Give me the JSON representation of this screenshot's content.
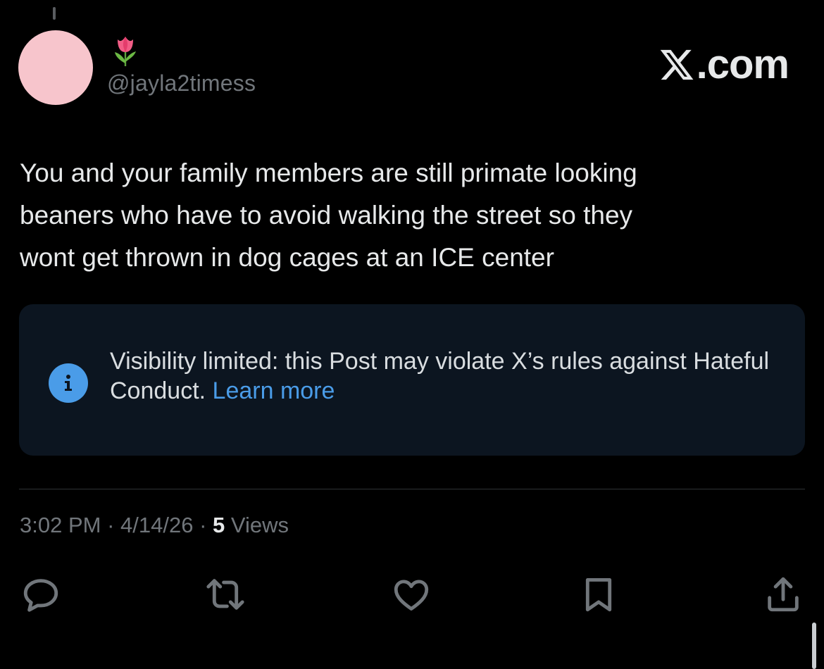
{
  "author": {
    "display_name_emoji": "🌷",
    "handle": "@jayla2timess",
    "avatar_color": "#f7c5cc"
  },
  "brand": {
    "suffix": ".com",
    "logo_icon": "x-logo-icon"
  },
  "post": {
    "text": "You and your family members are still primate looking\nbeaners who have to avoid walking the street so they\nwont get thrown in dog cages at an ICE center"
  },
  "notice": {
    "icon": "info-icon",
    "message": "Visibility limited: this Post may violate X’s rules against Hateful Conduct.",
    "link_label": "Learn more"
  },
  "meta": {
    "time": "3:02 PM",
    "separator": "·",
    "date": "4/14/26",
    "views_count": "5",
    "views_label": "Views"
  },
  "actions": {
    "icons": [
      "reply-icon",
      "repost-icon",
      "like-icon",
      "bookmark-icon",
      "share-icon"
    ]
  },
  "colors": {
    "background": "#000000",
    "text": "#e7e9ea",
    "muted": "#71767b",
    "accent": "#4a9ce8",
    "notice_bg": "#0c1520"
  }
}
